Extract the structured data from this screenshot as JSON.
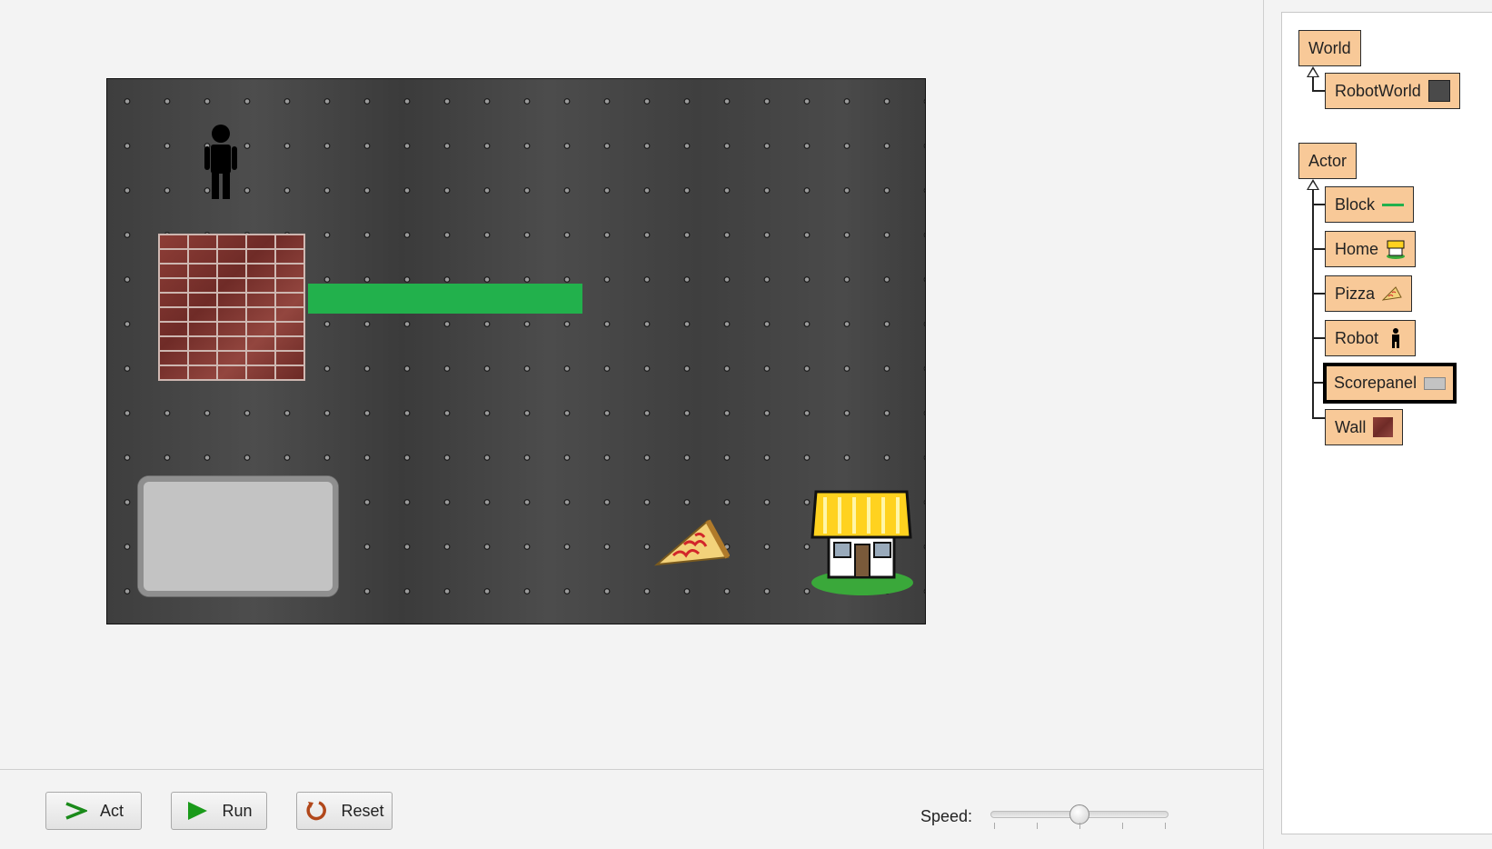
{
  "controls": {
    "act_label": "Act",
    "run_label": "Run",
    "reset_label": "Reset",
    "speed_label": "Speed:",
    "speed_value": 0.5
  },
  "class_tree": {
    "world_group": {
      "root": "World",
      "children": [
        "RobotWorld"
      ]
    },
    "actor_group": {
      "root": "Actor",
      "children": [
        "Block",
        "Home",
        "Pizza",
        "Robot",
        "Scorepanel",
        "Wall"
      ],
      "selected": "Scorepanel"
    }
  },
  "colors": {
    "class_box": "#f8c998",
    "block_green": "#22b14c",
    "world_background": "#444444"
  }
}
